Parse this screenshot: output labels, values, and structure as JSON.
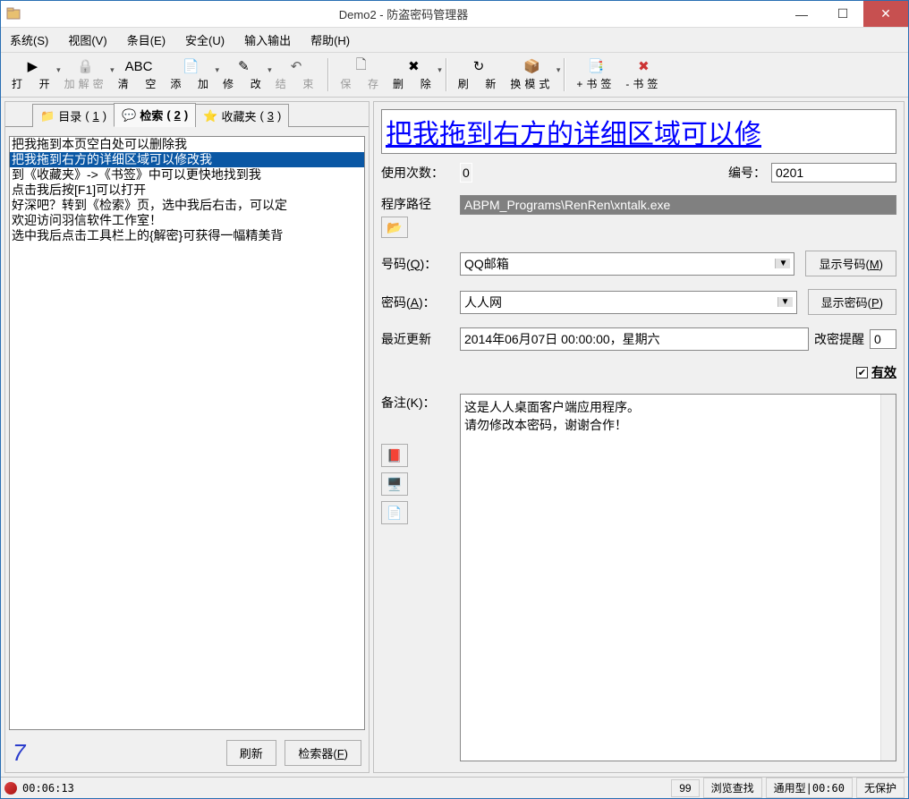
{
  "window": {
    "title": "Demo2 - 防盗密码管理器"
  },
  "menu": [
    "系统(S)",
    "视图(V)",
    "条目(E)",
    "安全(U)",
    "输入输出",
    "帮助(H)"
  ],
  "toolbar": [
    {
      "label": "打  开",
      "icon": "▶",
      "dd": true
    },
    {
      "label": "加解密",
      "icon": "🔒",
      "disabled": true,
      "dd": true
    },
    {
      "label": "清  空",
      "icon": "ABC"
    },
    {
      "label": "添  加",
      "icon": "📄",
      "dd": true
    },
    {
      "label": "修  改",
      "icon": "✎",
      "dd": true
    },
    {
      "label": "结  束",
      "icon": "↶",
      "disabled": true
    },
    {
      "sep": true
    },
    {
      "label": "保  存",
      "icon": "🗋",
      "disabled": true
    },
    {
      "label": "删  除",
      "icon": "✖",
      "dd": true
    },
    {
      "sep": true
    },
    {
      "label": "刷  新",
      "icon": "↻"
    },
    {
      "label": "换模式",
      "icon": "📦",
      "dd": true
    },
    {
      "sep": true
    },
    {
      "label": "+书签",
      "icon": "📑",
      "color": "#2a55cc"
    },
    {
      "label": "-书签",
      "icon": "✖",
      "color": "#c33"
    }
  ],
  "tabs": [
    {
      "icon": "📁",
      "label": "目录",
      "hk": "1"
    },
    {
      "icon": "💬",
      "label": "检索",
      "hk": "2",
      "active": true
    },
    {
      "icon": "⭐",
      "label": "收藏夹",
      "hk": "3"
    }
  ],
  "list": [
    "把我拖到本页空白处可以删除我",
    "把我拖到右方的详细区域可以修改我",
    "到《收藏夹》->《书签》中可以更快地找到我",
    "点击我后按[F1]可以打开",
    "好深吧？转到《检索》页，选中我后右击，可以定",
    "欢迎访问羽信软件工作室！",
    "选中我后点击工具栏上的{解密}可获得一幅精美背"
  ],
  "list_selected_index": 1,
  "count": "7",
  "left_buttons": {
    "refresh": "刷新",
    "search": "检索器",
    "search_hk": "F"
  },
  "banner": "把我拖到右方的详细区域可以修",
  "form": {
    "usage_label": "使用次数：",
    "usage_value": "0",
    "id_label": "编号：",
    "id_value": "0201",
    "path_label": "程序路径",
    "path_value": "ABPM_Programs\\RenRen\\xntalk.exe",
    "number_label": "号码",
    "number_hk": "Q",
    "number_value": "QQ邮箱",
    "show_number": "显示号码",
    "show_number_hk": "M",
    "pwd_label": "密码",
    "pwd_hk": "A",
    "pwd_value": "人人网",
    "show_pwd": "显示密码",
    "show_pwd_hk": "P",
    "update_label": "最近更新",
    "update_value": "2014年06月07日 00:00:00，星期六",
    "remind_label": "改密提醒",
    "remind_value": "0",
    "valid_label": "有效",
    "notes_label": "备注",
    "notes_hk": "K",
    "notes_value": "这是人人桌面客户端应用程序。\n请勿修改本密码，谢谢合作！"
  },
  "status": {
    "time": "00:06:13",
    "count": "99",
    "browse": "浏览查找",
    "type": "通用型|00:60",
    "protect": "无保护"
  }
}
